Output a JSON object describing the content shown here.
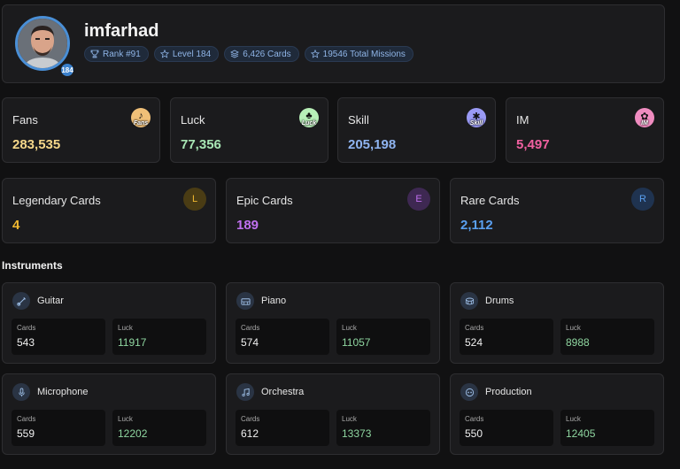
{
  "profile": {
    "username": "imfarhad",
    "level_badge": "184",
    "pills": [
      {
        "icon": "trophy-icon",
        "label": "Rank #91"
      },
      {
        "icon": "star-icon",
        "label": "Level 184"
      },
      {
        "icon": "layers-icon",
        "label": "6,426 Cards"
      },
      {
        "icon": "star-icon",
        "label": "19546 Total Missions"
      }
    ]
  },
  "stats": [
    {
      "label": "Fans",
      "value": "283,535",
      "color": "#f5d78a",
      "emblem_text": "Fans",
      "emblem_color": "#f0c078"
    },
    {
      "label": "Luck",
      "value": "77,356",
      "color": "#a8e6b4",
      "emblem_text": "Luck",
      "emblem_color": "#b8f0b8"
    },
    {
      "label": "Skill",
      "value": "205,198",
      "color": "#8fb4f0",
      "emblem_text": "Skill",
      "emblem_color": "#9a9af5"
    },
    {
      "label": "IM",
      "value": "5,497",
      "color": "#f060a0",
      "emblem_text": "IM",
      "emblem_color": "#f08cc0"
    }
  ],
  "rarities": [
    {
      "label": "Legendary Cards",
      "value": "4",
      "letter": "L",
      "color": "#f0b830",
      "circle_bg": "#4a3c14"
    },
    {
      "label": "Epic Cards",
      "value": "189",
      "letter": "E",
      "color": "#c070f0",
      "circle_bg": "#3e2852"
    },
    {
      "label": "Rare Cards",
      "value": "2,112",
      "letter": "R",
      "color": "#5aa0f0",
      "circle_bg": "#1f3350"
    }
  ],
  "instruments_title": "Instruments",
  "instrument_sublabels": {
    "cards": "Cards",
    "luck": "Luck"
  },
  "instruments": [
    {
      "name": "Guitar",
      "icon": "guitar-icon",
      "cards": "543",
      "luck": "11917"
    },
    {
      "name": "Piano",
      "icon": "piano-icon",
      "cards": "574",
      "luck": "11057"
    },
    {
      "name": "Drums",
      "icon": "drum-icon",
      "cards": "524",
      "luck": "8988"
    },
    {
      "name": "Microphone",
      "icon": "microphone-icon",
      "cards": "559",
      "luck": "12202"
    },
    {
      "name": "Orchestra",
      "icon": "music-note-icon",
      "cards": "612",
      "luck": "13373"
    },
    {
      "name": "Production",
      "icon": "production-icon",
      "cards": "550",
      "luck": "12405"
    }
  ]
}
